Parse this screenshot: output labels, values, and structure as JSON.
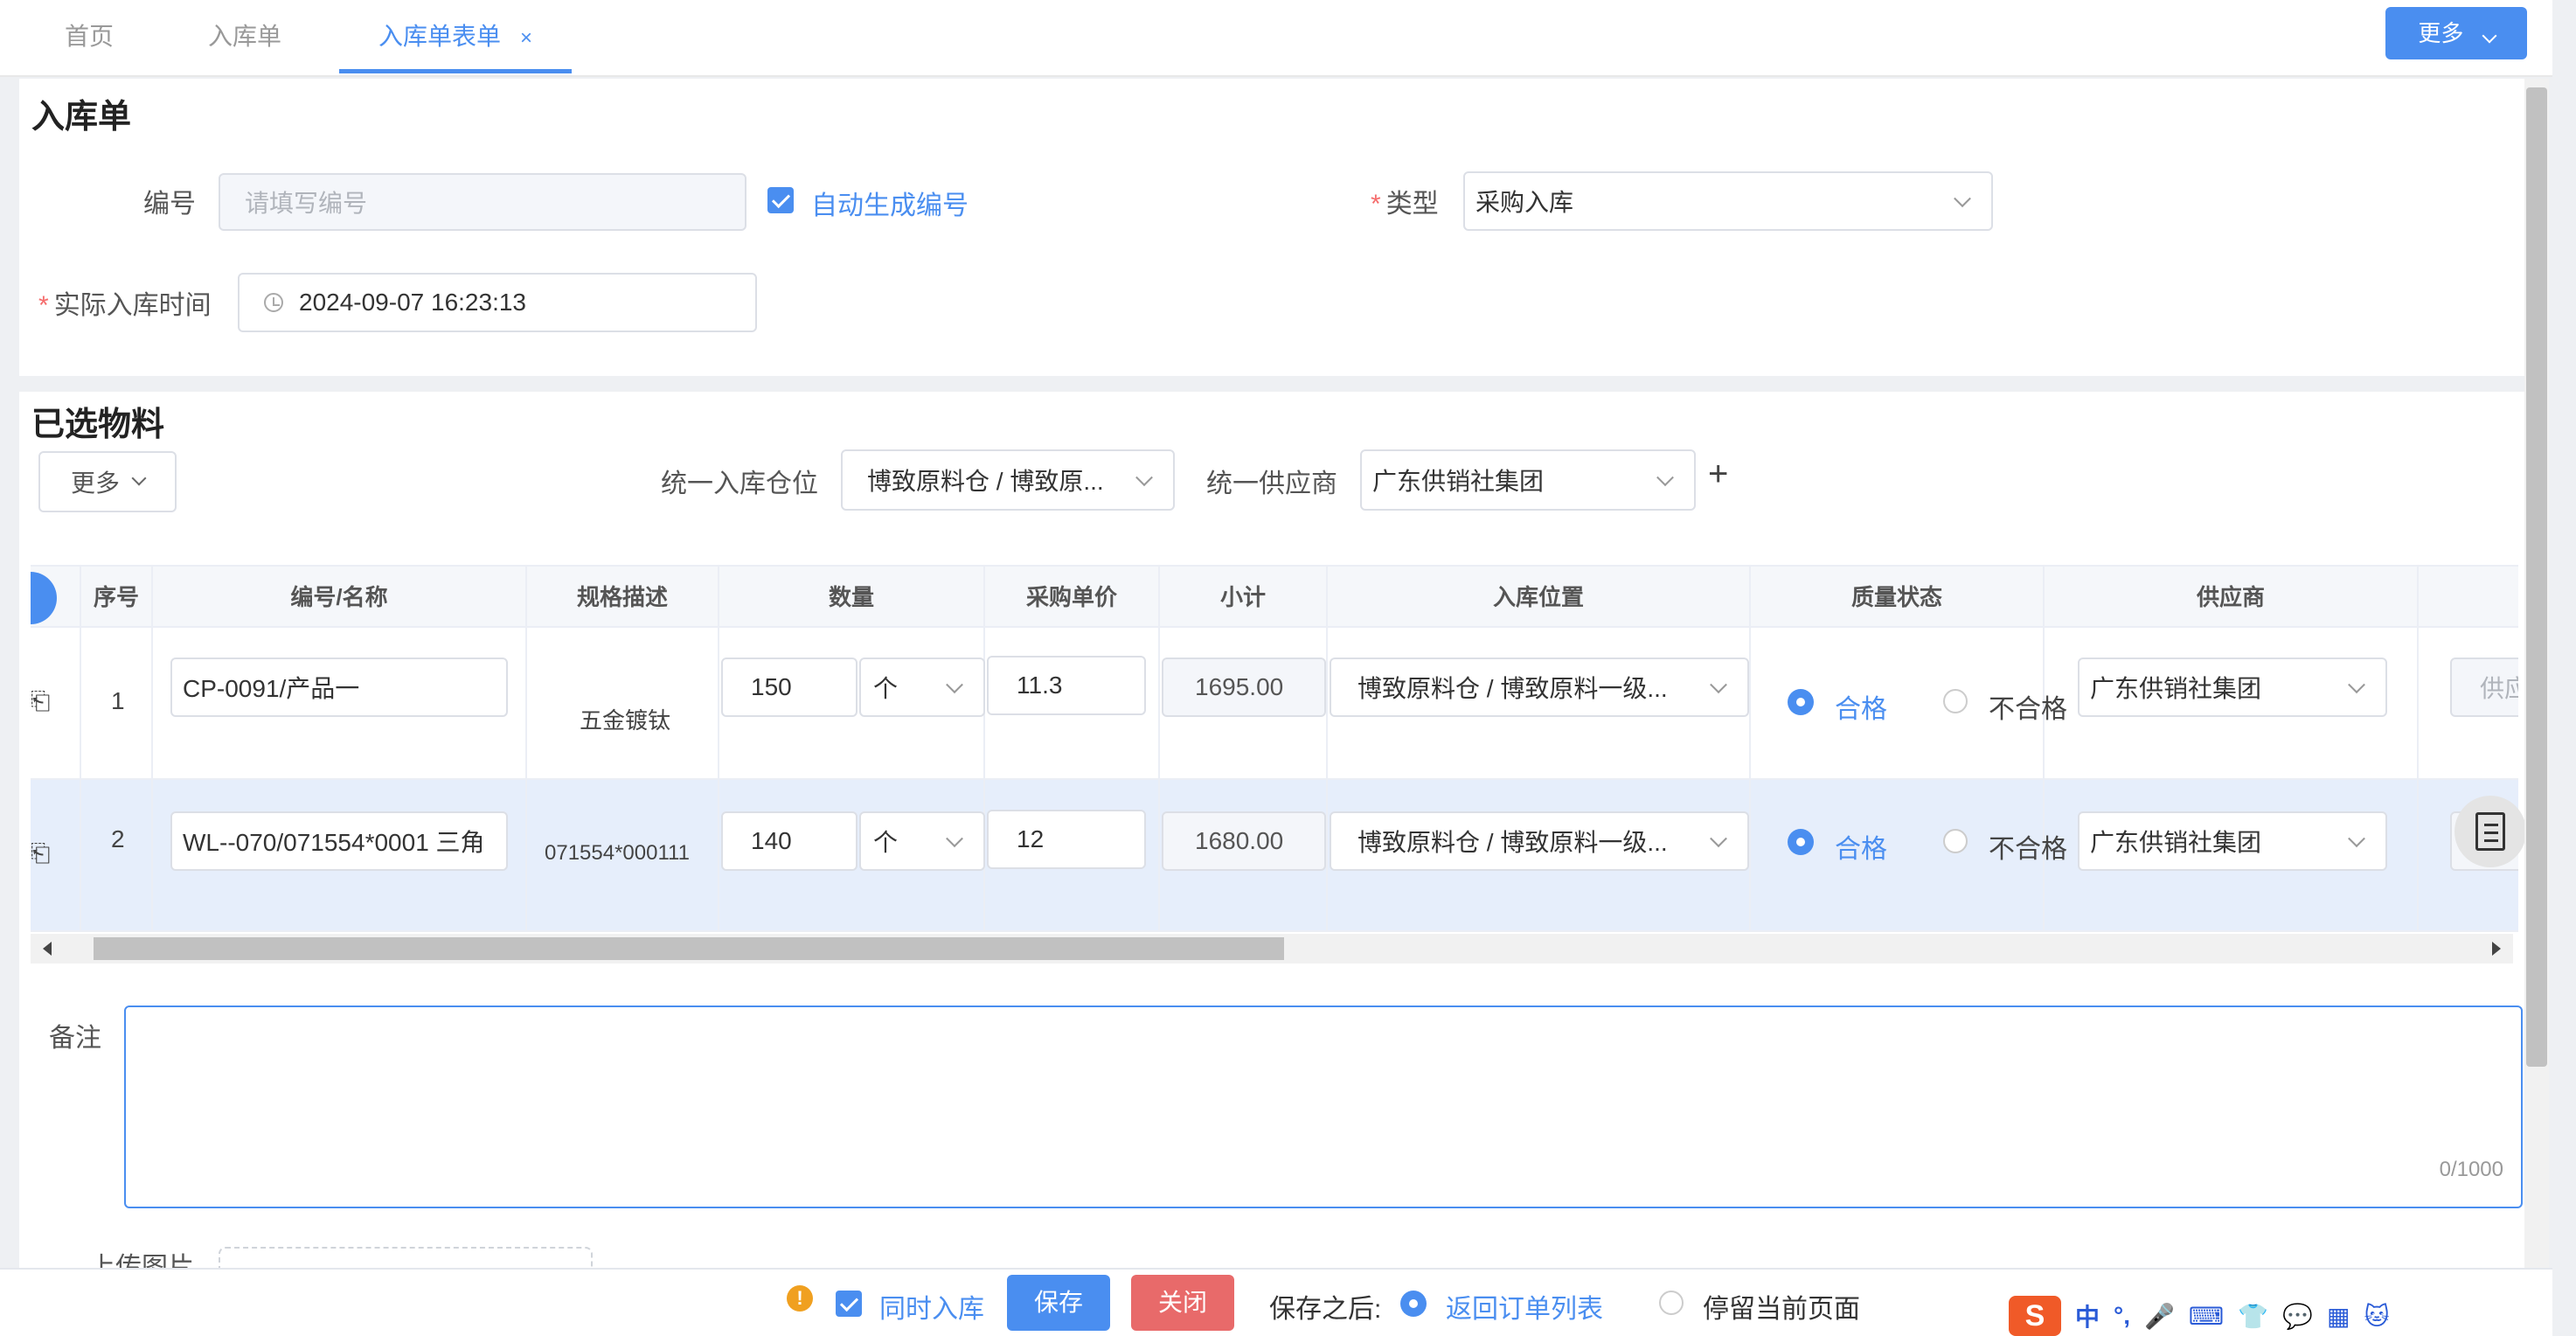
{
  "tabs": [
    {
      "label": "首页"
    },
    {
      "label": "入库单"
    },
    {
      "label": "入库单表单",
      "close": "×"
    }
  ],
  "top_more_label": "更多",
  "form": {
    "title": "入库单",
    "code_label": "编号",
    "code_placeholder": "请填写编号",
    "auto_code_label": "自动生成编号",
    "type_label": "类型",
    "type_value": "采购入库",
    "time_label": "实际入库时间",
    "time_value": "2024-09-07 16:23:13"
  },
  "materials": {
    "title": "已选物料",
    "more_label": "更多",
    "warehouse_label": "统一入库仓位",
    "warehouse_value": "博致原料仓 / 博致原...",
    "supplier_label": "统一供应商",
    "supplier_value": "广东供销社集团",
    "plus": "+"
  },
  "table": {
    "headers": [
      "序号",
      "编号/名称",
      "规格描述",
      "数量",
      "采购单价",
      "小计",
      "入库位置",
      "质量状态",
      "供应商"
    ],
    "rows": [
      {
        "index": "1",
        "code_name": "CP-0091/产品一",
        "spec": "五金镀钛",
        "qty": "150",
        "unit": "个",
        "price": "11.3",
        "subtotal": "1695.00",
        "location": "博致原料仓 / 博致原料一级...",
        "quality_ok": "合格",
        "quality_bad": "不合格",
        "supplier": "广东供销社集团",
        "supplier_batch": "供应批"
      },
      {
        "index": "2",
        "code_name": "WL--070/071554*0001  三角",
        "spec": "071554*000111",
        "qty": "140",
        "unit": "个",
        "price": "12",
        "subtotal": "1680.00",
        "location": "博致原料仓 / 博致原料一级...",
        "quality_ok": "合格",
        "quality_bad": "不合格",
        "supplier": "广东供销社集团",
        "supplier_batch": ""
      }
    ]
  },
  "remark": {
    "label": "备注",
    "counter": "0/1000"
  },
  "upload_label_partial": "上传图片",
  "footer": {
    "warn": "!",
    "simultaneous_label": "同时入库",
    "save_label": "保存",
    "close_label": "关闭",
    "after_save_label": "保存之后:",
    "return_label": "返回订单列表",
    "stay_label": "停留当前页面"
  },
  "ime": {
    "logo": "S",
    "mode": "中",
    "punct": "°,"
  },
  "colors": {
    "primary": "#4a8ef0",
    "danger": "#e86a6a",
    "required": "#f56c6c"
  }
}
